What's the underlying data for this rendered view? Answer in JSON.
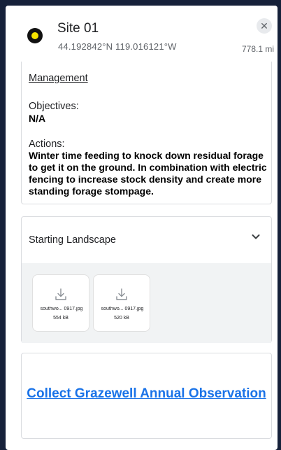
{
  "header": {
    "site_title": "Site 01",
    "coordinates": "44.192842°N 119.016121°W",
    "distance": "778.1 mi",
    "close_symbol": "✕",
    "marker_colors": {
      "outer": "#111111",
      "inner": "#f5e400"
    }
  },
  "management": {
    "heading": "Management",
    "objectives_label": "Objectives:",
    "objectives_value": "N/A",
    "actions_label": "Actions:",
    "actions_value": "Winter time feeding to knock down residual forage to get it on the ground. In combination with electric fencing to increase stock density and create more standing forage stompage."
  },
  "starting_landscape": {
    "title": "Starting Landscape",
    "files": [
      {
        "name": "southwo... 0917.jpg",
        "size": "554 kB"
      },
      {
        "name": "southwo... 0917.jpg",
        "size": "520 kB"
      }
    ]
  },
  "collect": {
    "link_text": "Collect Grazewell Annual Observation",
    "link_color": "#1a73e8"
  }
}
